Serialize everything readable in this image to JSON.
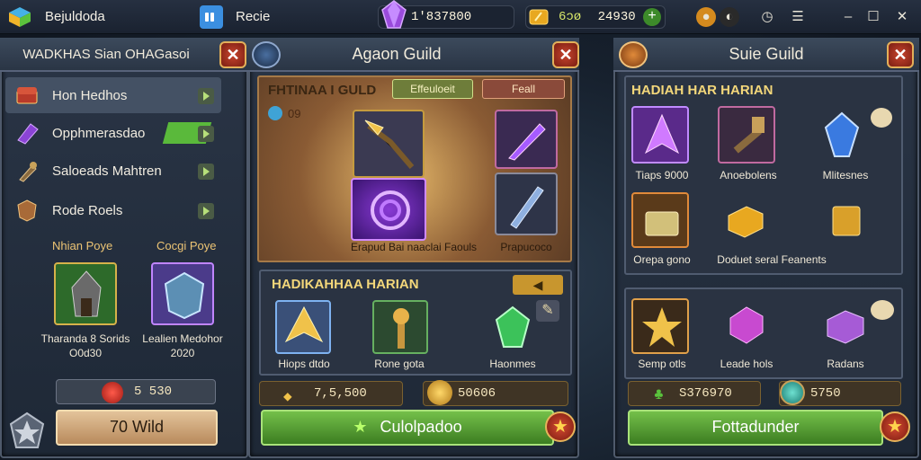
{
  "app": {
    "title": "Bejuldoda",
    "tab_label": "Recie"
  },
  "resources": {
    "gems": "1'837800",
    "gold_prefix": "6ɔø",
    "gold": "24930"
  },
  "left": {
    "title": "WADKHAS Sian OHAGasoi",
    "menu": [
      {
        "label": "Hon Hedhos",
        "icon": "chest-icon"
      },
      {
        "label": "Opphmerasdao",
        "icon": "crystal-icon"
      },
      {
        "label": "Saloeads Mahtren",
        "icon": "bag-icon"
      },
      {
        "label": "Rode Roels",
        "icon": "shield-icon"
      }
    ],
    "rewards": [
      {
        "heading": "Nhian Poye",
        "name": "Tharanda 8 Sorids",
        "sub": "O0d30"
      },
      {
        "heading": "Cocgi Poye",
        "name": "Lealien Medohor",
        "sub": "2020"
      }
    ],
    "currency": "5 530",
    "button": "70 Wild"
  },
  "middle": {
    "title": "Agaon Guild",
    "section1": {
      "title": "FHTINAA I GULD",
      "badge": "Effeuloeit",
      "badge2": "Feall",
      "count": "09",
      "caption": "Erapud Bai naaclai Faouls",
      "side_caption": "Prapucoco"
    },
    "section2": {
      "title": "HADIKAHHAA HARIAN",
      "items": [
        {
          "label": "Hiops dtdo"
        },
        {
          "label": "Rone gota"
        },
        {
          "label": "Haonmes"
        }
      ]
    },
    "bar1": "7,5,500",
    "bar2": "50606",
    "button": "Culolpadoo"
  },
  "right": {
    "title": "Suie Guild",
    "section1": {
      "title": "HADIAH HAR HARIAN",
      "items": [
        "Tiaps 9000",
        "Anoebolens",
        "Mlitesnes"
      ],
      "row2": [
        "Orepa gono",
        "Doduet seral Feanents"
      ]
    },
    "section2": {
      "items": [
        "Semp otls",
        "Leade hols",
        "Radans"
      ]
    },
    "bar1": "S376970",
    "bar2": "5750",
    "button": "Fottadunder"
  },
  "colors": {
    "accent": "#f3d77a",
    "green": "#5aa83a",
    "red": "#b63a24",
    "panel": "#26313f"
  }
}
